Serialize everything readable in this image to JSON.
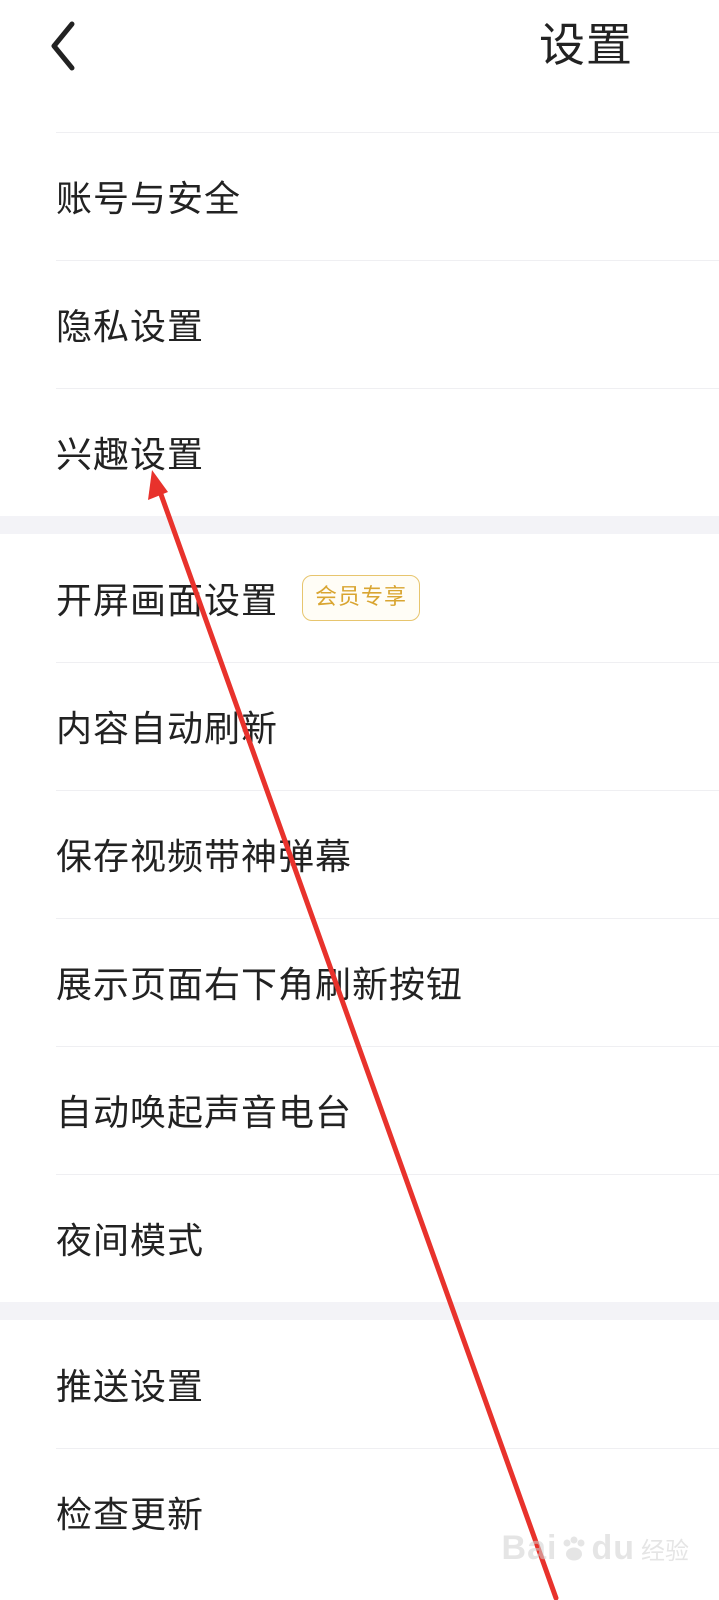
{
  "header": {
    "title": "设置"
  },
  "groups": [
    {
      "items": [
        {
          "label": "账号与安全"
        },
        {
          "label": "隐私设置"
        },
        {
          "label": "兴趣设置"
        }
      ]
    },
    {
      "items": [
        {
          "label": "开屏画面设置",
          "badge": "会员专享"
        },
        {
          "label": "内容自动刷新"
        },
        {
          "label": "保存视频带神弹幕"
        },
        {
          "label": "展示页面右下角刷新按钮"
        },
        {
          "label": "自动唤起声音电台"
        },
        {
          "label": "夜间模式"
        }
      ]
    },
    {
      "items": [
        {
          "label": "推送设置"
        },
        {
          "label": "检查更新"
        }
      ]
    }
  ],
  "watermark": {
    "brand": "Bai",
    "brand2": "du",
    "sub": "经验"
  },
  "colors": {
    "badge_border": "#e7c56e",
    "badge_text": "#d9a531",
    "separator": "#f3f3f7",
    "annotation_arrow": "#e8322c"
  }
}
